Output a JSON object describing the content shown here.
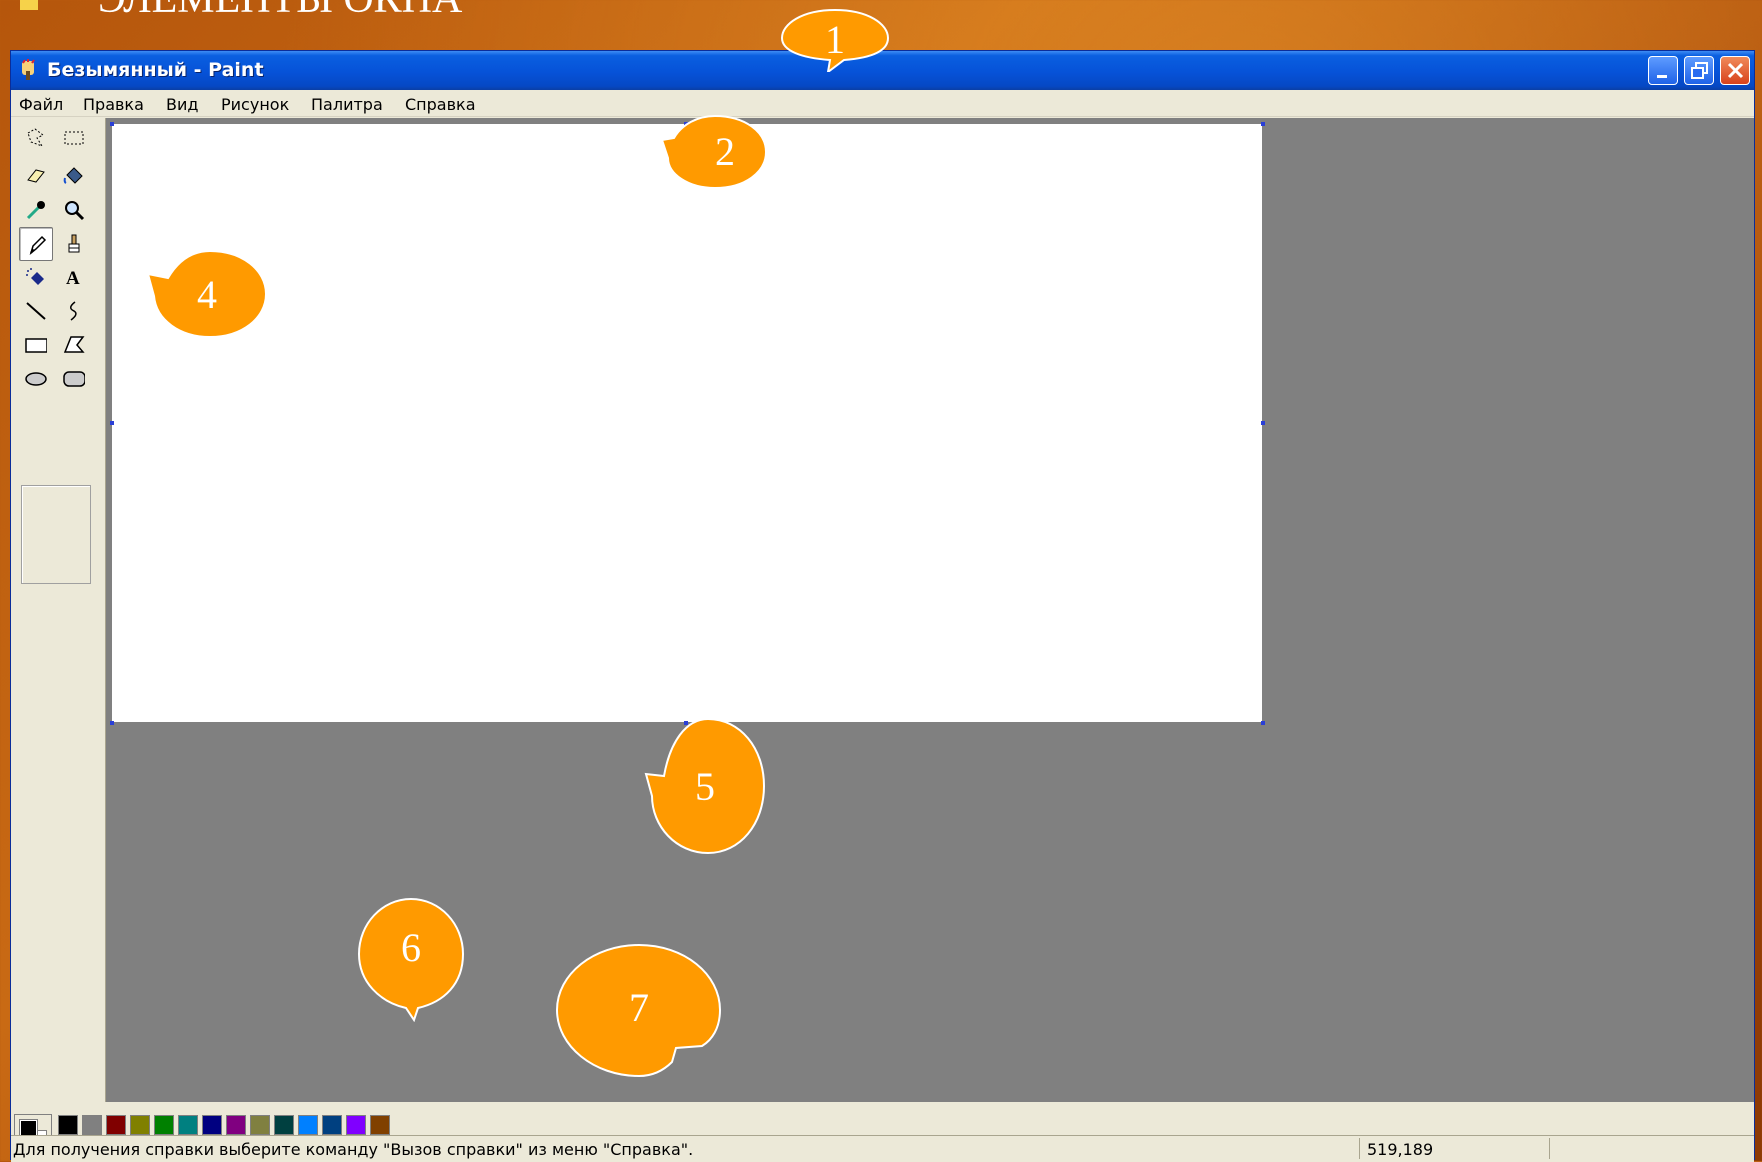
{
  "slide": {
    "title": "ЭЛЕМЕНТЫ ОКНА"
  },
  "window": {
    "title": "Безымянный - Paint",
    "controls": [
      "minimize-icon",
      "restore-icon",
      "close-icon"
    ]
  },
  "menu": [
    "Файл",
    "Правка",
    "Вид",
    "Рисунок",
    "Палитра",
    "Справка"
  ],
  "tools": [
    "free-select-icon",
    "rect-select-icon",
    "eraser-icon",
    "fill-icon",
    "color-picker-icon",
    "magnifier-icon",
    "pencil-icon",
    "brush-icon",
    "airbrush-icon",
    "text-icon",
    "line-icon",
    "curve-icon",
    "rectangle-icon",
    "polygon-icon",
    "ellipse-icon",
    "rounded-rect-icon"
  ],
  "selected_tool": "pencil-icon",
  "palette": {
    "foreground": "#000000",
    "background": "#ffffff",
    "row1": [
      "#000000",
      "#808080",
      "#800000",
      "#808000",
      "#008000",
      "#008080",
      "#000080",
      "#800080",
      "#808040",
      "#004040",
      "#0080ff",
      "#004080",
      "#8000ff",
      "#804000"
    ],
    "row2": [
      "#ffffff",
      "#c0c0c0",
      "#ff0000",
      "#ffff00",
      "#00ff00",
      "#00ffff",
      "#0000ff",
      "#ff00ff",
      "#ffff80",
      "#00ff80",
      "#80ffff",
      "#8080ff",
      "#ff0080",
      "#ff8040"
    ]
  },
  "status": {
    "help": "Для получения справки выберите команду \"Вызов справки\" из меню \"Справка\".",
    "coords": "519,189"
  },
  "callouts": [
    "1",
    "2",
    "4",
    "5",
    "6",
    "7"
  ],
  "colors": {
    "callout": "#ff9a00",
    "titlebar": "#0652d8",
    "workspace": "#808080"
  }
}
